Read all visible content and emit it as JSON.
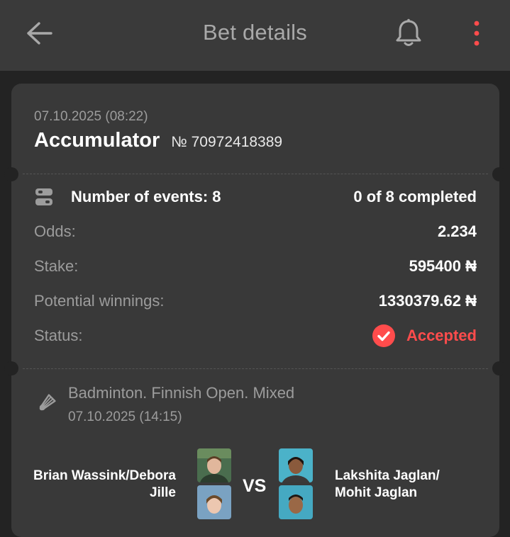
{
  "header": {
    "title": "Bet details",
    "back_icon": "arrow-left-icon",
    "bell_icon": "bell-icon",
    "more_icon": "more-vertical-icon",
    "accent_color": "#ff4c4c"
  },
  "bet": {
    "datetime": "07.10.2025 (08:22)",
    "type": "Accumulator",
    "number": "№ 70972418389",
    "events_label": "Number of events: 8",
    "progress": "0 of 8 completed",
    "odds_label": "Odds:",
    "odds_value": "2.234",
    "stake_label": "Stake:",
    "stake_value": "595400 ₦",
    "winnings_label": "Potential winnings:",
    "winnings_value": "1330379.62 ₦",
    "status_label": "Status:",
    "status_value": "Accepted",
    "status_icon": "check-circle-icon"
  },
  "event": {
    "sport_icon": "shuttlecock-icon",
    "title": "Badminton. Finnish Open. Mixed",
    "datetime": "07.10.2025 (14:15)",
    "team1_line1": "Brian Wassink/Debora",
    "team1_line2": "Jille",
    "vs": "VS",
    "team2_line1": "Lakshita Jaglan/",
    "team2_line2": "Mohit Jaglan"
  }
}
